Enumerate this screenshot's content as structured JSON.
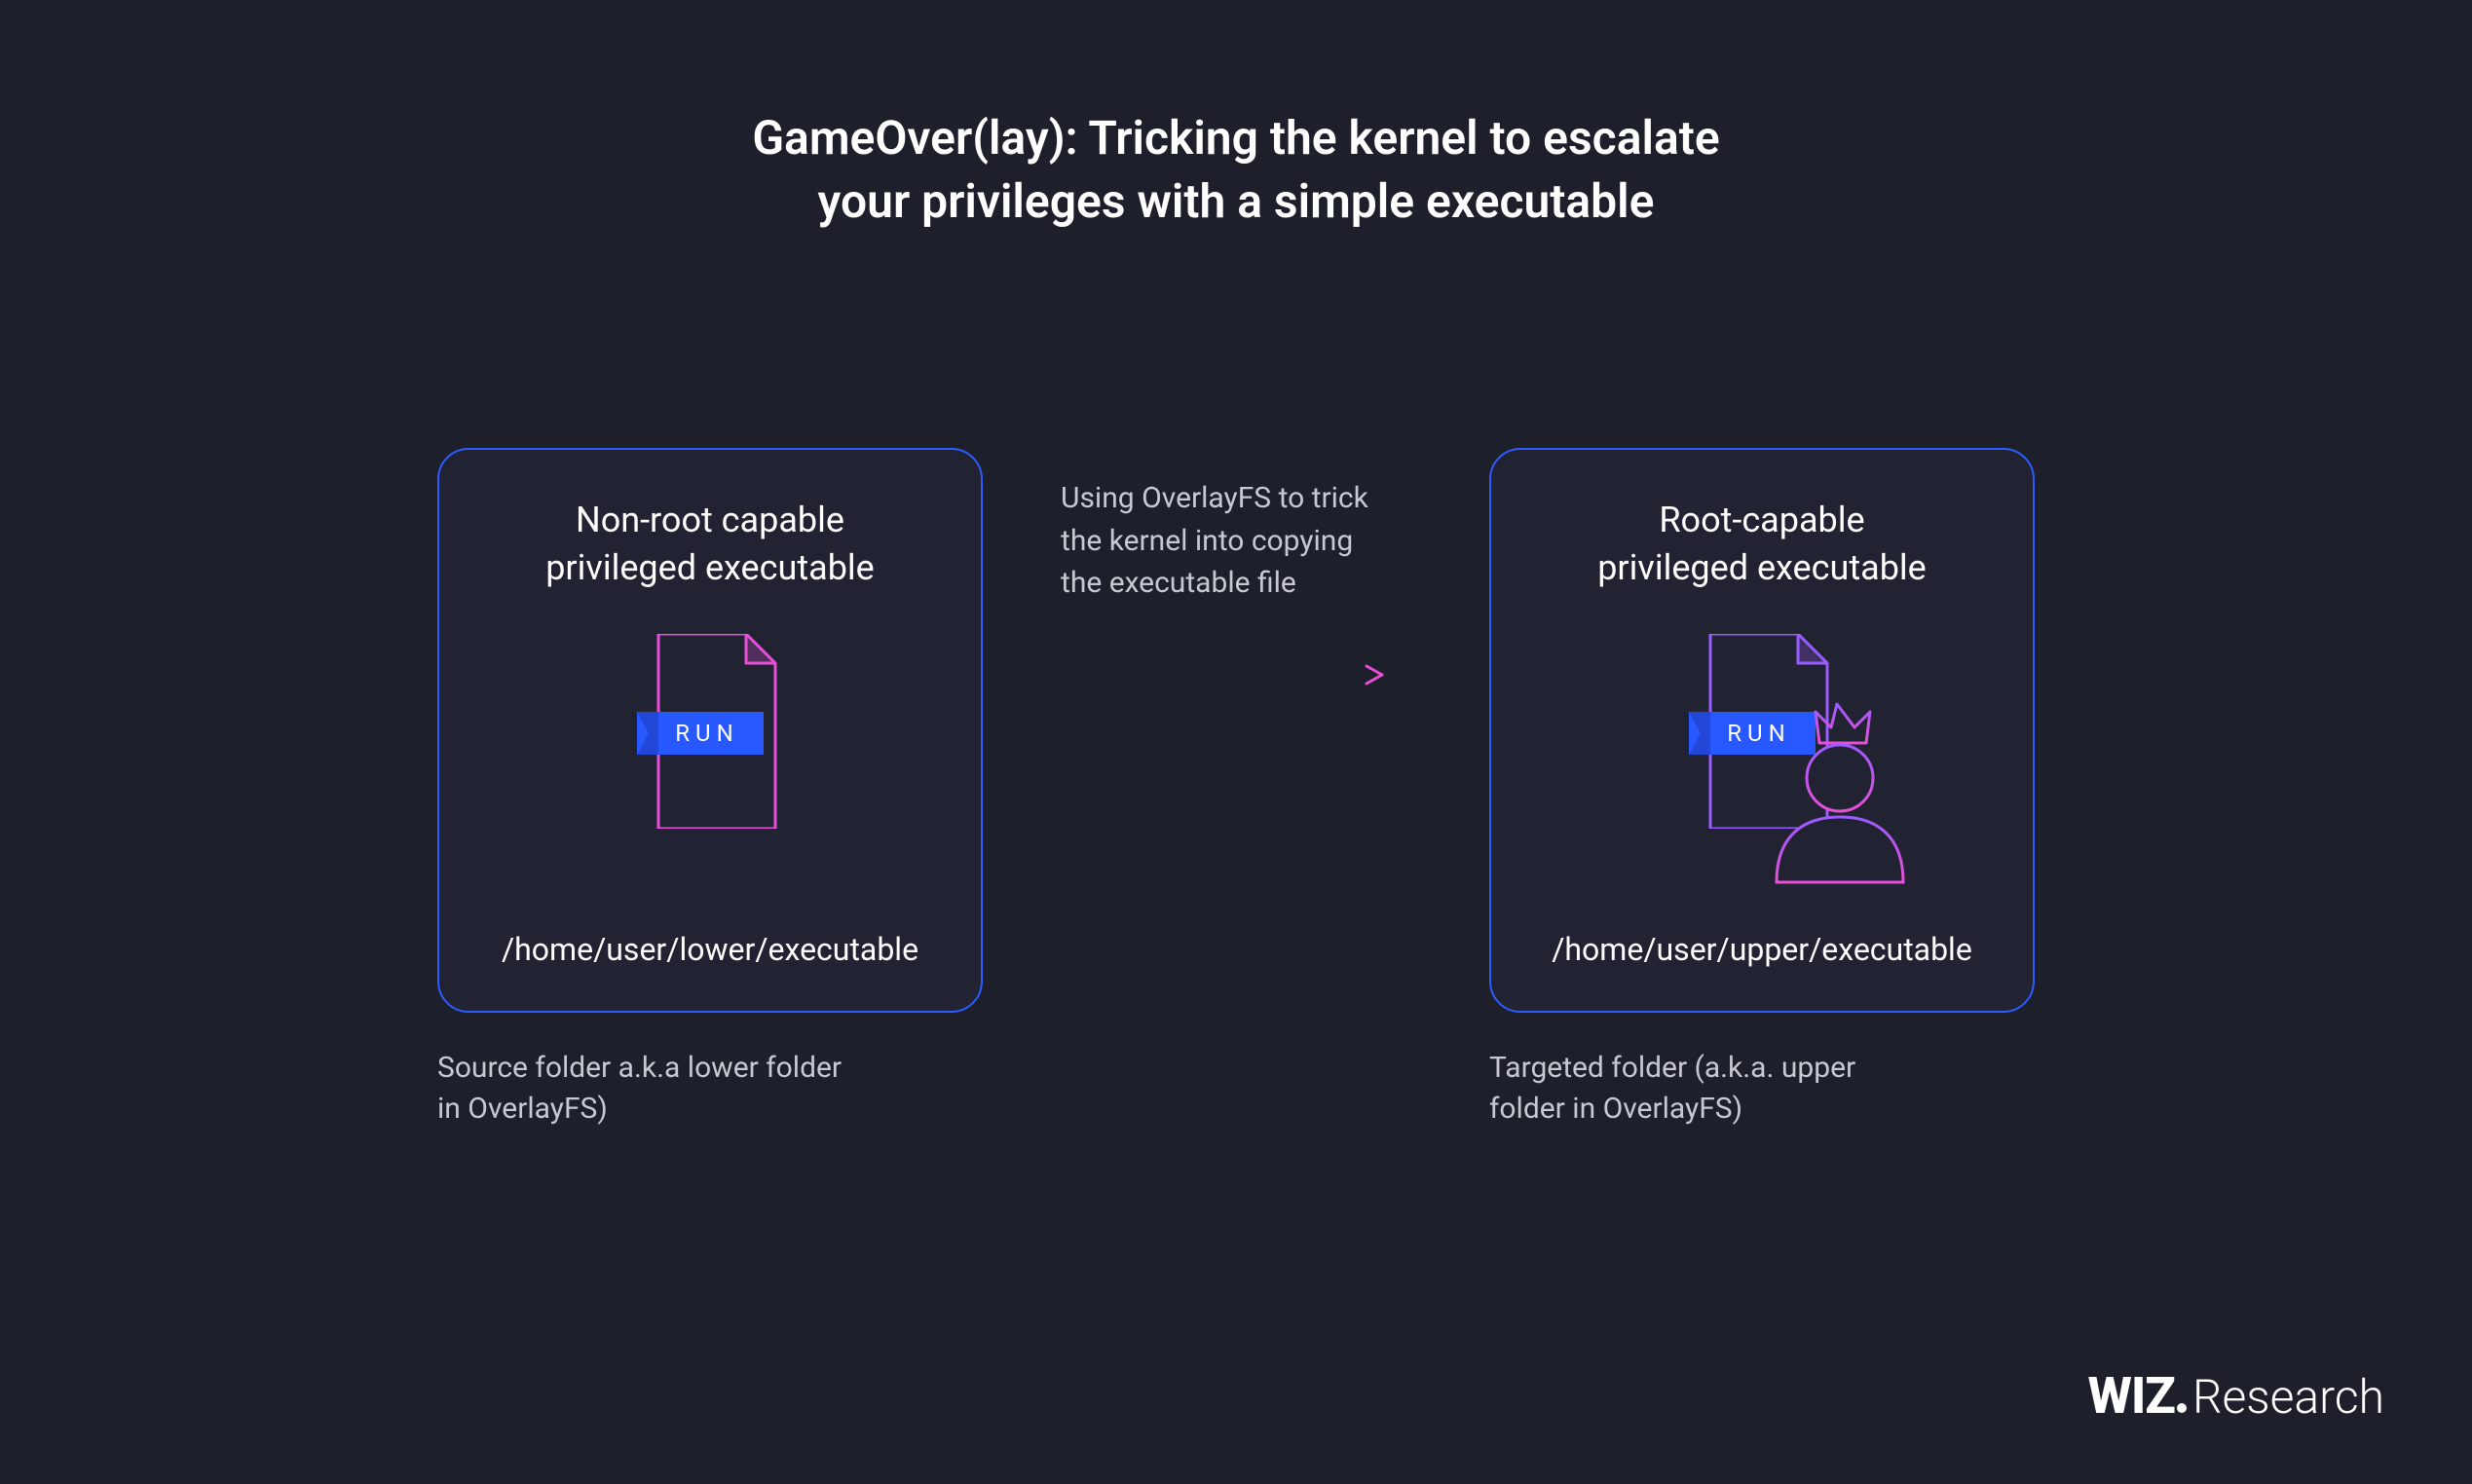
{
  "title_line1": "GameOver(lay): Tricking the kernel to escalate",
  "title_line2": "your privileges with a simple executable",
  "left": {
    "heading_line1": "Non-root capable",
    "heading_line2": "privileged executable",
    "run_label": "RUN",
    "path": "/home/user/lower/executable",
    "caption_line1": "Source folder a.k.a lower folder",
    "caption_line2": "in OverlayFS)"
  },
  "middle": {
    "text_line1": "Using OverlayFS to trick",
    "text_line2": "the kernel into copying",
    "text_line3": "the executable file"
  },
  "right": {
    "heading_line1": "Root-capable",
    "heading_line2": "privileged executable",
    "run_label": "RUN",
    "path": "/home/user/upper/executable",
    "caption_line1": "Targeted folder (a.k.a. upper",
    "caption_line2": "folder in OverlayFS)"
  },
  "logo": {
    "brand": "WIZ",
    "suffix": "Research"
  }
}
